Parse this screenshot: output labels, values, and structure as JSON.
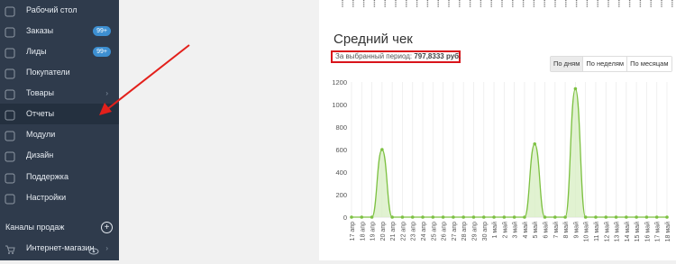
{
  "sidebar": {
    "items": [
      {
        "label": "Рабочий стол",
        "icon": "dashboard-icon"
      },
      {
        "label": "Заказы",
        "badge": "99+",
        "icon": "orders-icon"
      },
      {
        "label": "Лиды",
        "badge": "99+",
        "icon": "leads-icon"
      },
      {
        "label": "Покупатели",
        "icon": "customers-icon"
      },
      {
        "label": "Товары",
        "chevron": "›",
        "icon": "products-icon"
      },
      {
        "label": "Отчеты",
        "icon": "reports-icon",
        "active": true
      },
      {
        "label": "Модули",
        "icon": "modules-icon"
      },
      {
        "label": "Дизайн",
        "icon": "design-icon"
      },
      {
        "label": "Поддержка",
        "icon": "support-icon"
      },
      {
        "label": "Настройки",
        "icon": "settings-icon"
      }
    ],
    "channels_title": "Каналы продаж",
    "channels_add": "+",
    "channels": [
      {
        "label": "Интернет-магазин",
        "icon": "cart-icon",
        "chevron": "›"
      }
    ]
  },
  "report": {
    "title": "Средний чек",
    "period_label": "За выбранный период:",
    "period_value": "797,8333 руб.",
    "tabs": [
      "По дням",
      "По неделям",
      "По месяцам"
    ],
    "active_tab": 0
  },
  "colors": {
    "sidebar_bg": "#2f3b4c",
    "line": "#7dc142",
    "fill": "#d9efc6",
    "highlight": "#d9141b"
  },
  "chart_data": {
    "type": "area",
    "x": [
      "17 апр",
      "18 апр",
      "19 апр",
      "20 апр",
      "21 апр",
      "22 апр",
      "23 апр",
      "24 апр",
      "25 апр",
      "26 апр",
      "27 апр",
      "28 апр",
      "29 апр",
      "30 апр",
      "1 май",
      "2 май",
      "3 май",
      "4 май",
      "5 май",
      "6 май",
      "7 май",
      "8 май",
      "9 май",
      "10 май",
      "11 май",
      "12 май",
      "13 май",
      "14 май",
      "15 май",
      "16 май",
      "17 май",
      "18 май"
    ],
    "values": [
      0,
      0,
      0,
      600,
      0,
      0,
      0,
      0,
      0,
      0,
      0,
      0,
      0,
      0,
      0,
      0,
      0,
      0,
      650,
      0,
      0,
      0,
      1140,
      0,
      0,
      0,
      0,
      0,
      0,
      0,
      0,
      0
    ],
    "ylim": [
      0,
      1200
    ],
    "yticks": [
      0,
      200,
      400,
      600,
      800,
      1000,
      1200
    ],
    "grid": "vertical"
  }
}
